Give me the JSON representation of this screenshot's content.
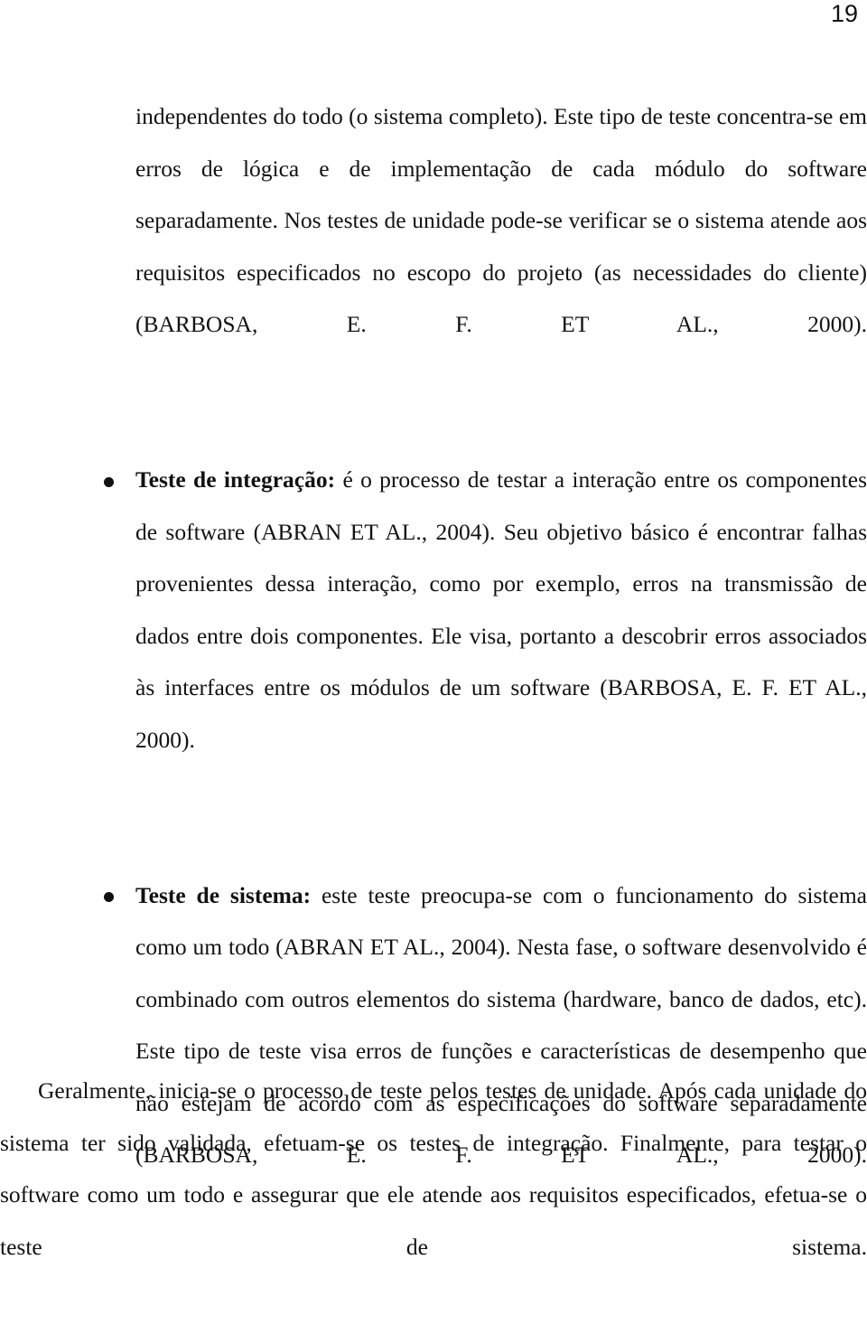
{
  "document": {
    "page_number": "19",
    "language": "pt-BR",
    "paragraphs": {
      "p1": "independentes do todo (o sistema completo). Este tipo de teste concentra-se em erros de lógica e de implementação de cada módulo do software separadamente.  Nos testes de unidade pode-se verificar se o sistema atende aos requisitos especificados no escopo do projeto (as necessidades do cliente) (BARBOSA, E. F. ET AL., 2000).",
      "closing": "Geralmente, inicia-se o processo de teste pelos testes de unidade. Após cada unidade do sistema ter sido validada, efetuam-se os testes de integração. Finalmente, para testar o software como um todo e assegurar que ele atende aos requisitos especificados, efetua-se o teste de sistema."
    },
    "bullets": [
      {
        "marker": "•",
        "lead": "Teste de integração:",
        "text": " é o processo de testar a interação entre os componentes de software (ABRAN ET AL., 2004). Seu objetivo básico é encontrar falhas provenientes dessa interação, como por exemplo, erros na transmissão de dados entre dois componentes. Ele visa, portanto a descobrir erros associados às interfaces entre os módulos de um software (BARBOSA, E. F. ET AL., 2000)."
      },
      {
        "marker": "•",
        "lead": "Teste de sistema:",
        "text": " este teste preocupa-se com o funcionamento do sistema como um todo (ABRAN ET AL., 2004). Nesta fase, o software desenvolvido é combinado com outros elementos do sistema (hardware, banco de dados, etc). Este tipo de teste visa erros de funções e características de desempenho que não estejam de acordo com as especificações do software separadamente (BARBOSA, E. F. ET AL., 2000)."
      }
    ]
  }
}
